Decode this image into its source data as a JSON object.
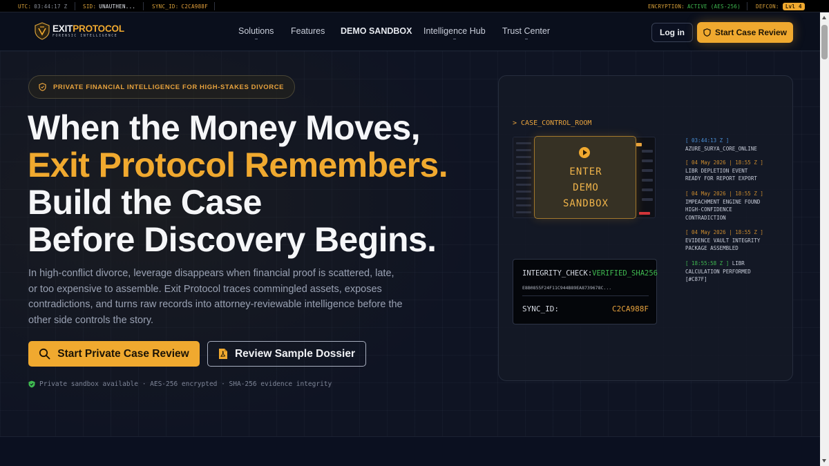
{
  "status_bar": {
    "utc_label": "UTC:",
    "utc_value": "03:44:17 Z",
    "sid_label": "SID:",
    "sid_value": "UNAUTHEN...",
    "sync_label": "SYNC_ID:",
    "sync_value": "C2CA988F",
    "encryption_label": "ENCRYPTION:",
    "encryption_value": "ACTIVE (AES-256)",
    "defcon_label": "DEFCON:",
    "defcon_value": "Lvl 4"
  },
  "nav": {
    "logo_prefix": "EXIT",
    "logo_suffix": "PROTOCOL",
    "logo_tagline": "FORENSIC INTELLIGENCE",
    "links": [
      {
        "label": "Solutions"
      },
      {
        "label": "Features"
      },
      {
        "label": "DEMO SANDBOX"
      },
      {
        "label": "Intelligence Hub"
      },
      {
        "label": "Trust Center"
      }
    ],
    "login_label": "Log in",
    "cta_label": "Start Case Review"
  },
  "hero": {
    "badge": "PRIVATE FINANCIAL INTELLIGENCE FOR HIGH-STAKES DIVORCE",
    "headline_line1": "When the Money Moves,",
    "headline_line2": "Exit Protocol Remembers.",
    "headline_line3": "Build the Case",
    "headline_line4": "Before Discovery Begins.",
    "lede": "In high-conflict divorce, leverage disappears when financial proof is scattered, late, or too expensive to assemble. Exit Protocol traces commingled assets, exposes contradictions, and turns raw records into attorney-reviewable intelligence before the other side controls the story.",
    "primary_cta": "Start Private Case Review",
    "secondary_cta": "Review Sample Dossier",
    "trust_line": "Private sandbox available · AES-256 encrypted · SHA-256 evidence integrity"
  },
  "control_room": {
    "title": "> CASE_CONTROL_ROOM",
    "enter_demo": [
      "ENTER",
      "DEMO",
      "SANDBOX"
    ],
    "integrity_label": "INTEGRITY_CHECK:",
    "integrity_value": "VERIFIED_SHA256",
    "hash": "E8B0855F24F11C944B89EA8739678C...",
    "sync_label": "SYNC_ID:",
    "sync_value": "C2CA988F",
    "log": [
      {
        "ts": "[ 03:44:13 Z ]",
        "msg": [
          "AZURE_SURYA_CORE_ONLINE"
        ],
        "tone": "b"
      },
      {
        "ts": "[ 04 May 2026 | 18:55 Z ]",
        "msg": [
          "LIBR DEPLETION EVENT",
          "READY FOR REPORT EXPORT"
        ],
        "tone": "o"
      },
      {
        "ts": "[ 04 May 2026 | 18:55 Z ]",
        "msg": [
          "IMPEACHMENT ENGINE FOUND",
          "HIGH-CONFIDENCE",
          "CONTRADICTION"
        ],
        "tone": "o"
      },
      {
        "ts": "[ 04 May 2026 | 18:55 Z ]",
        "msg": [
          "EVIDENCE VAULT INTEGRITY",
          "PACKAGE ASSEMBLED"
        ],
        "tone": "o"
      },
      {
        "ts": "[ 18:55:58 Z ]",
        "ts_suffix": " LIBR",
        "msg": [
          "CALCULATION PERFORMED",
          "[#C87F]"
        ],
        "tone": "g"
      }
    ]
  },
  "colors": {
    "accent": "#f0a92f",
    "background": "#0c1120",
    "success": "#3fb950",
    "info": "#4a8fd6"
  }
}
